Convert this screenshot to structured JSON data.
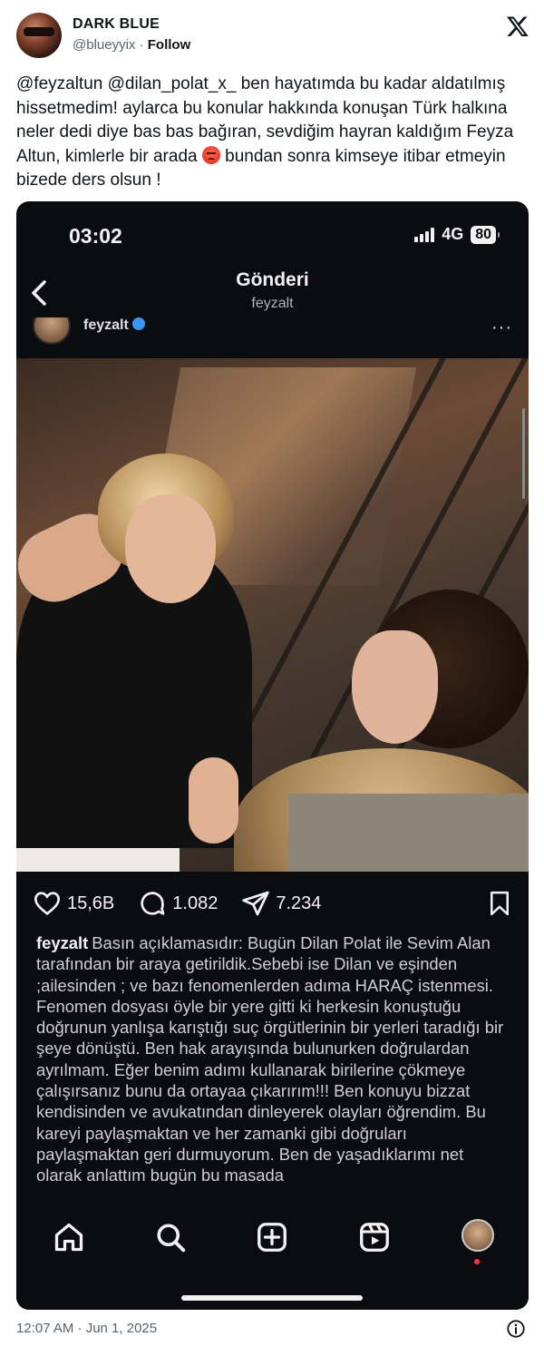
{
  "tweet": {
    "author_name": "DARK BLUE",
    "author_handle": "@blueyyix",
    "separator": " · ",
    "follow_label": "Follow",
    "text_before_emoji": "@feyzaltun @dilan_polat_x_ ben hayatımda bu kadar aldatılmış hissetmedim! aylarca bu konular hakkında konuşan Türk halkına neler dedi diye bas bas bağıran, sevdiğim hayran kaldığım Feyza Altun, kimlerle bir arada ",
    "emoji": "angry-face-icon",
    "text_after_emoji": " bundan sonra kimseye itibar etmeyin bizede ders olsun !",
    "timestamp": "12:07 AM · Jun 1, 2025"
  },
  "phone": {
    "status_time": "03:02",
    "network": "4G",
    "battery": "80",
    "nav_title": "Gönderi",
    "nav_subtitle": "feyzalt",
    "post_username": "feyzalt",
    "more_label": "···",
    "likes": "15,6B",
    "comments": "1.082",
    "shares": "7.234",
    "caption_user": "feyzalt",
    "caption_text": "Basın açıklamasıdır: Bugün Dilan Polat ile Sevim Alan tarafından bir araya getirildik.Sebebi ise Dilan ve eşinden ;ailesinden ; ve bazı fenomenlerden adıma HARAÇ istenmesi. Fenomen dosyası öyle bir yere gitti ki herkesin konuştuğu doğrunun yanlışa karıştığı suç örgütlerinin bir yerleri taradığı bir şeye dönüştü. Ben hak arayışında bulunurken doğrulardan ayrılmam. Eğer benim adımı kullanarak birilerine çökmeye çalışırsanız bunu da ortayaa çıkarırım!!! Ben konuyu bizzat kendisinden ve avukatından dinleyerek olayları öğrendim. Bu kareyi paylaşmaktan ve her zamanki gibi doğruları paylaşmaktan geri durmuyorum. Ben de yaşadıklarımı net olarak anlattım bugün bu masada"
  },
  "icons": {
    "brand": "x-logo-icon",
    "info": "info-icon"
  },
  "colors": {
    "text": "#0f1419",
    "muted": "#536471",
    "phone_bg": "#0b0c0f",
    "notification_dot": "#ff3040"
  }
}
